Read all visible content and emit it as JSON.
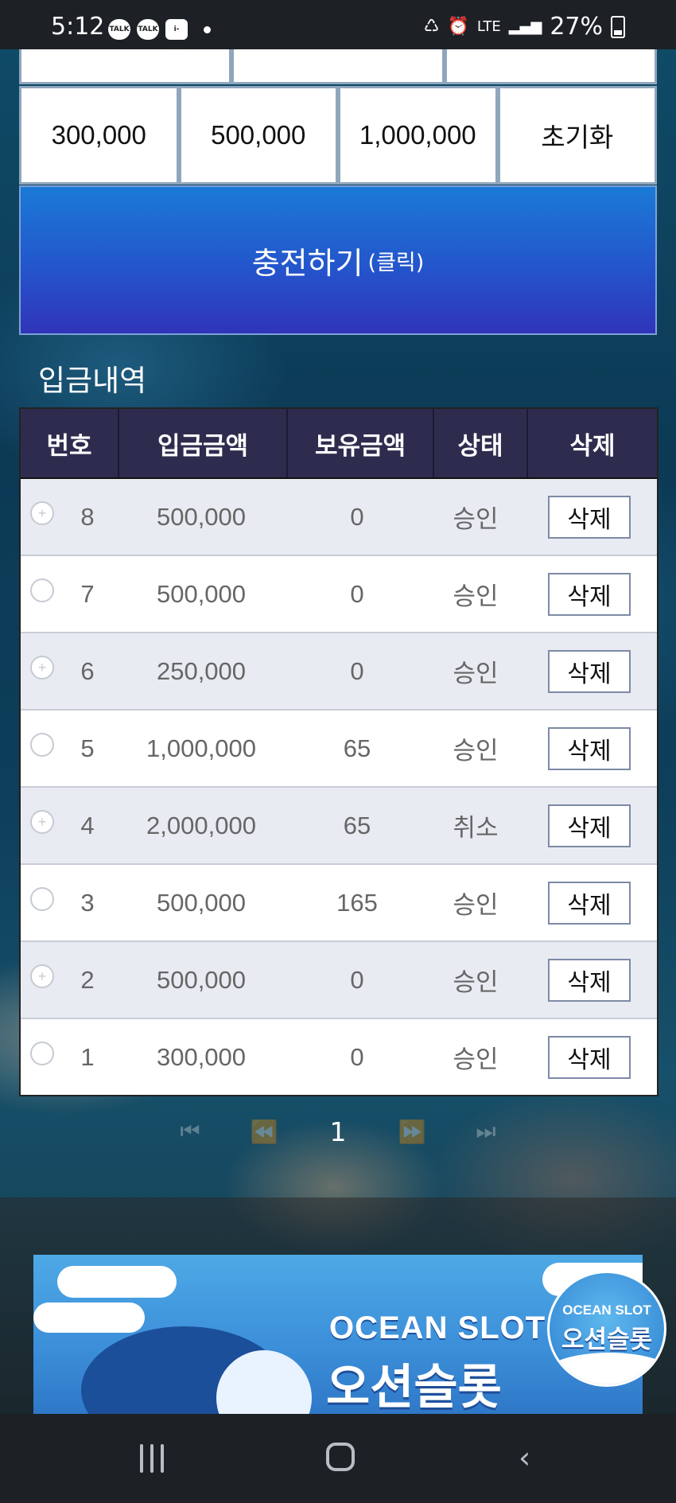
{
  "status_bar": {
    "time": "5:12",
    "notifications": [
      "TALK",
      "TALK",
      "i-ONE"
    ],
    "network": "LTE",
    "battery": "27%"
  },
  "quick_amounts": [
    "300,000",
    "500,000",
    "1,000,000"
  ],
  "reset_label": "초기화",
  "charge_button": {
    "main": "충전하기",
    "sub": "(클릭)"
  },
  "deposit_history": {
    "title": "입금내역",
    "columns": [
      "번호",
      "입금금액",
      "보유금액",
      "상태",
      "삭제"
    ],
    "rows": [
      {
        "no": "8",
        "deposit": "500,000",
        "held": "0",
        "status": "승인",
        "action": "삭제"
      },
      {
        "no": "7",
        "deposit": "500,000",
        "held": "0",
        "status": "승인",
        "action": "삭제"
      },
      {
        "no": "6",
        "deposit": "250,000",
        "held": "0",
        "status": "승인",
        "action": "삭제"
      },
      {
        "no": "5",
        "deposit": "1,000,000",
        "held": "65",
        "status": "승인",
        "action": "삭제"
      },
      {
        "no": "4",
        "deposit": "2,000,000",
        "held": "65",
        "status": "취소",
        "action": "삭제"
      },
      {
        "no": "3",
        "deposit": "500,000",
        "held": "165",
        "status": "승인",
        "action": "삭제"
      },
      {
        "no": "2",
        "deposit": "500,000",
        "held": "0",
        "status": "승인",
        "action": "삭제"
      },
      {
        "no": "1",
        "deposit": "300,000",
        "held": "0",
        "status": "승인",
        "action": "삭제"
      }
    ]
  },
  "pagination": {
    "first_icon": "⏮",
    "prev_icon": "⏪",
    "current_page": "1",
    "next_icon": "⏩",
    "last_icon": "⏭"
  },
  "banner": {
    "title_en": "OCEAN SLOT",
    "title_ko": "오션슬롯",
    "badge_en": "OCEAN SLOT",
    "badge_ko": "오션슬롯"
  }
}
